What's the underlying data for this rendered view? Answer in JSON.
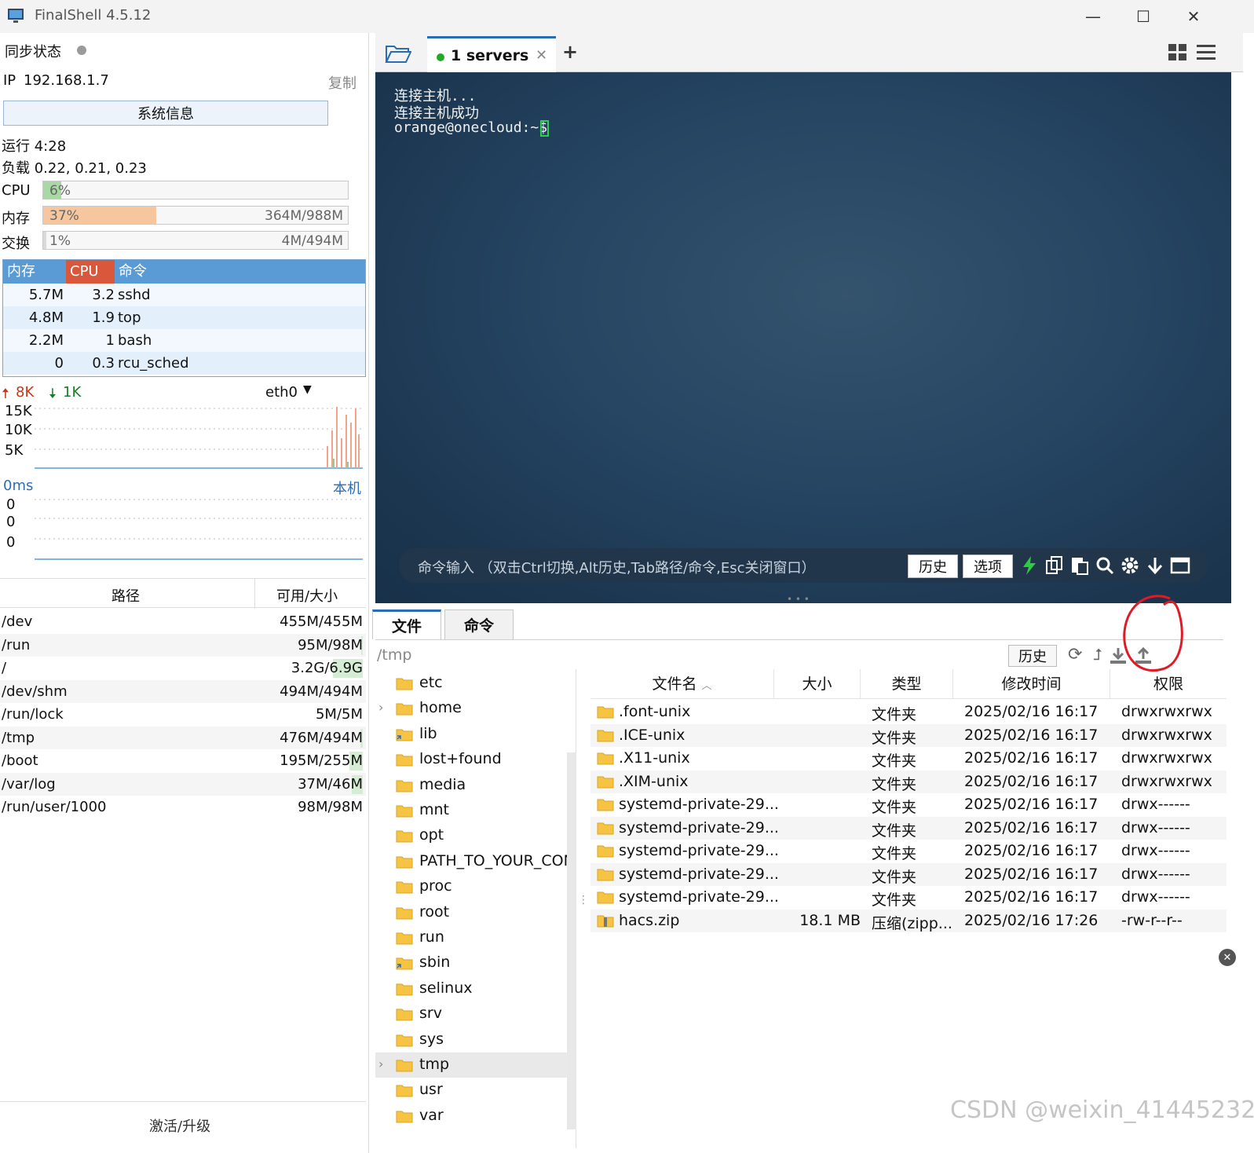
{
  "window": {
    "title": "FinalShell 4.5.12",
    "controls": [
      "—",
      "☐",
      "✕"
    ]
  },
  "sidebar": {
    "sync_label": "同步状态",
    "ip_label": "IP",
    "ip_value": "192.168.1.7",
    "copy_label": "复制",
    "sysinfo_button": "系统信息",
    "uptime": "运行 4:28",
    "load": "负载 0.22, 0.21, 0.23",
    "meters": [
      {
        "label": "CPU",
        "percent_text": "6%",
        "percent": 6,
        "detail": "",
        "color": "#a8d8a4"
      },
      {
        "label": "内存",
        "percent_text": "37%",
        "percent": 37,
        "detail": "364M/988M",
        "color": "#f6c79f"
      },
      {
        "label": "交换",
        "percent_text": "1%",
        "percent": 1,
        "detail": "4M/494M",
        "color": "#d9d9d9"
      }
    ],
    "process_table": {
      "headers": [
        "内存",
        "CPU",
        "命令"
      ],
      "rows": [
        {
          "mem": "5.7M",
          "cpu": "3.2",
          "cmd": "sshd"
        },
        {
          "mem": "4.8M",
          "cpu": "1.9",
          "cmd": "top"
        },
        {
          "mem": "2.2M",
          "cpu": "1",
          "cmd": "bash"
        },
        {
          "mem": "0",
          "cpu": "0.3",
          "cmd": "rcu_sched"
        }
      ]
    },
    "network": {
      "up": "8K",
      "down": "1K",
      "interface": "eth0",
      "ticks": [
        "15K",
        "10K",
        "5K"
      ]
    },
    "ping": {
      "latency": "0ms",
      "target": "本机",
      "ticks": [
        "0",
        "0",
        "0"
      ]
    },
    "disk_table": {
      "headers": [
        "路径",
        "可用/大小"
      ],
      "rows": [
        {
          "path": "/dev",
          "size": "455M/455M",
          "used": 0
        },
        {
          "path": "/run",
          "size": "95M/98M",
          "used": 3
        },
        {
          "path": "/",
          "size": "3.2G/6.9G",
          "used": 54
        },
        {
          "path": "/dev/shm",
          "size": "494M/494M",
          "used": 0
        },
        {
          "path": "/run/lock",
          "size": "5M/5M",
          "used": 0
        },
        {
          "path": "/tmp",
          "size": "476M/494M",
          "used": 4
        },
        {
          "path": "/boot",
          "size": "195M/255M",
          "used": 24
        },
        {
          "path": "/var/log",
          "size": "37M/46M",
          "used": 20
        },
        {
          "path": "/run/user/1000",
          "size": "98M/98M",
          "used": 0
        }
      ]
    },
    "activate_label": "激活/升级"
  },
  "tabs": {
    "active_label": "1 servers",
    "status_color": "#22aa22"
  },
  "terminal": {
    "lines": [
      "连接主机...",
      "连接主机成功",
      "orange@onecloud:~$ "
    ],
    "command_hint": "命令输入 （双击Ctrl切换,Alt历史,Tab路径/命令,Esc关闭窗口）",
    "history_button": "历史",
    "options_button": "选项"
  },
  "file_panel": {
    "tabs": [
      "文件",
      "命令"
    ],
    "path": "/tmp",
    "history_button": "历史",
    "tree": [
      {
        "name": "etc",
        "expandable": false,
        "selected": false,
        "link": false
      },
      {
        "name": "home",
        "expandable": true,
        "selected": false,
        "link": false
      },
      {
        "name": "lib",
        "expandable": false,
        "selected": false,
        "link": true
      },
      {
        "name": "lost+found",
        "expandable": false,
        "selected": false,
        "link": false
      },
      {
        "name": "media",
        "expandable": false,
        "selected": false,
        "link": false
      },
      {
        "name": "mnt",
        "expandable": false,
        "selected": false,
        "link": false
      },
      {
        "name": "opt",
        "expandable": false,
        "selected": false,
        "link": false
      },
      {
        "name": "PATH_TO_YOUR_CON",
        "expandable": false,
        "selected": false,
        "link": false
      },
      {
        "name": "proc",
        "expandable": false,
        "selected": false,
        "link": false
      },
      {
        "name": "root",
        "expandable": false,
        "selected": false,
        "link": false
      },
      {
        "name": "run",
        "expandable": false,
        "selected": false,
        "link": false
      },
      {
        "name": "sbin",
        "expandable": false,
        "selected": false,
        "link": true
      },
      {
        "name": "selinux",
        "expandable": false,
        "selected": false,
        "link": false
      },
      {
        "name": "srv",
        "expandable": false,
        "selected": false,
        "link": false
      },
      {
        "name": "sys",
        "expandable": false,
        "selected": false,
        "link": false
      },
      {
        "name": "tmp",
        "expandable": true,
        "selected": true,
        "link": false
      },
      {
        "name": "usr",
        "expandable": false,
        "selected": false,
        "link": false
      },
      {
        "name": "var",
        "expandable": false,
        "selected": false,
        "link": false
      }
    ],
    "columns": [
      "文件名",
      "大小",
      "类型",
      "修改时间",
      "权限"
    ],
    "files": [
      {
        "name": ".font-unix",
        "size": "",
        "type": "文件夹",
        "mtime": "2025/02/16 16:17",
        "perm": "drwxrwxrwx",
        "zip": false
      },
      {
        "name": ".ICE-unix",
        "size": "",
        "type": "文件夹",
        "mtime": "2025/02/16 16:17",
        "perm": "drwxrwxrwx",
        "zip": false
      },
      {
        "name": ".X11-unix",
        "size": "",
        "type": "文件夹",
        "mtime": "2025/02/16 16:17",
        "perm": "drwxrwxrwx",
        "zip": false
      },
      {
        "name": ".XIM-unix",
        "size": "",
        "type": "文件夹",
        "mtime": "2025/02/16 16:17",
        "perm": "drwxrwxrwx",
        "zip": false
      },
      {
        "name": "systemd-private-29...",
        "size": "",
        "type": "文件夹",
        "mtime": "2025/02/16 16:17",
        "perm": "drwx------",
        "zip": false
      },
      {
        "name": "systemd-private-29...",
        "size": "",
        "type": "文件夹",
        "mtime": "2025/02/16 16:17",
        "perm": "drwx------",
        "zip": false
      },
      {
        "name": "systemd-private-29...",
        "size": "",
        "type": "文件夹",
        "mtime": "2025/02/16 16:17",
        "perm": "drwx------",
        "zip": false
      },
      {
        "name": "systemd-private-29...",
        "size": "",
        "type": "文件夹",
        "mtime": "2025/02/16 16:17",
        "perm": "drwx------",
        "zip": false
      },
      {
        "name": "systemd-private-29...",
        "size": "",
        "type": "文件夹",
        "mtime": "2025/02/16 16:17",
        "perm": "drwx------",
        "zip": false
      },
      {
        "name": "hacs.zip",
        "size": "18.1 MB",
        "type": "压缩(zipp...",
        "mtime": "2025/02/16 17:26",
        "perm": "-rw-r--r--",
        "zip": true
      }
    ]
  },
  "watermark": "CSDN @weixin_41445232"
}
